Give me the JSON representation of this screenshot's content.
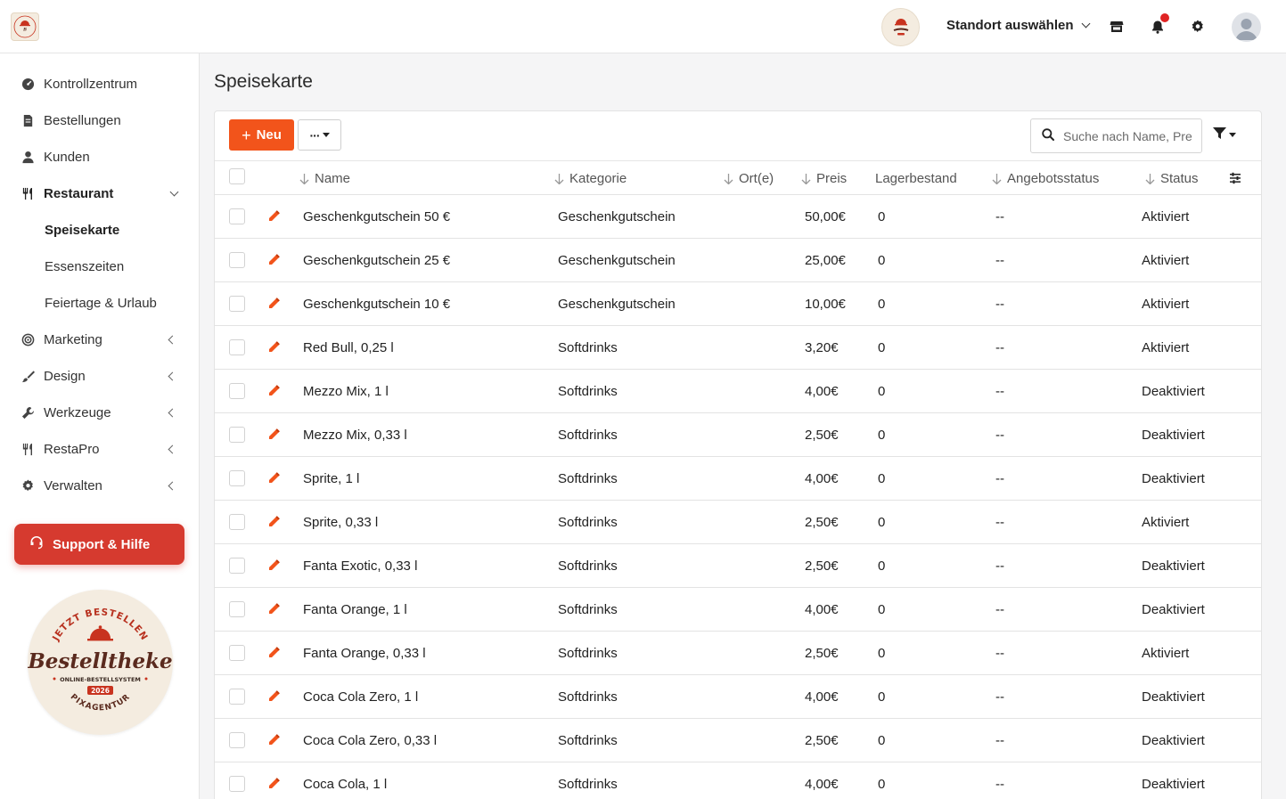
{
  "header": {
    "location_label": "Standort auswählen",
    "colors": {
      "accent": "#f2541b",
      "support": "#d63a2f",
      "notif": "#e02424"
    }
  },
  "sidebar": {
    "items": [
      {
        "label": "Kontrollzentrum",
        "icon": "gauge-icon"
      },
      {
        "label": "Bestellungen",
        "icon": "receipt-icon"
      },
      {
        "label": "Kunden",
        "icon": "user-icon"
      },
      {
        "label": "Restaurant",
        "icon": "utensils-icon"
      },
      {
        "label": "Marketing",
        "icon": "bullseye-icon"
      },
      {
        "label": "Design",
        "icon": "brush-icon"
      },
      {
        "label": "Werkzeuge",
        "icon": "wrench-icon"
      },
      {
        "label": "RestaPro",
        "icon": "utensils-icon"
      },
      {
        "label": "Verwalten",
        "icon": "gear-icon"
      }
    ],
    "subitems": [
      "Speisekarte",
      "Essenszeiten",
      "Feiertage & Urlaub"
    ],
    "support_label": "Support & Hilfe",
    "badge": {
      "top": "JETZT BESTELLEN",
      "name": "Bestelltheke",
      "tagline": "ONLINE-BESTELLSYSTEM",
      "year": "2026",
      "bottom": "PIXAGENTUR"
    }
  },
  "main": {
    "title": "Speisekarte",
    "new_label": "Neu",
    "more_label": "···",
    "search_placeholder": "Suche nach Name, Preis",
    "columns": [
      "Name",
      "Kategorie",
      "Ort(e)",
      "Preis",
      "Lagerbestand",
      "Angebotsstatus",
      "Status"
    ],
    "rows": [
      {
        "name": "Geschenkgutschein 50 €",
        "category": "Geschenkgutschein",
        "price": "50,00€",
        "stock": "0",
        "offer": "--",
        "status": "Aktiviert"
      },
      {
        "name": "Geschenkgutschein 25 €",
        "category": "Geschenkgutschein",
        "price": "25,00€",
        "stock": "0",
        "offer": "--",
        "status": "Aktiviert"
      },
      {
        "name": "Geschenkgutschein 10 €",
        "category": "Geschenkgutschein",
        "price": "10,00€",
        "stock": "0",
        "offer": "--",
        "status": "Aktiviert"
      },
      {
        "name": "Red Bull, 0,25 l",
        "category": "Softdrinks",
        "price": "3,20€",
        "stock": "0",
        "offer": "--",
        "status": "Aktiviert"
      },
      {
        "name": "Mezzo Mix, 1 l",
        "category": "Softdrinks",
        "price": "4,00€",
        "stock": "0",
        "offer": "--",
        "status": "Deaktiviert"
      },
      {
        "name": "Mezzo Mix, 0,33 l",
        "category": "Softdrinks",
        "price": "2,50€",
        "stock": "0",
        "offer": "--",
        "status": "Deaktiviert"
      },
      {
        "name": "Sprite, 1 l",
        "category": "Softdrinks",
        "price": "4,00€",
        "stock": "0",
        "offer": "--",
        "status": "Deaktiviert"
      },
      {
        "name": "Sprite, 0,33 l",
        "category": "Softdrinks",
        "price": "2,50€",
        "stock": "0",
        "offer": "--",
        "status": "Aktiviert"
      },
      {
        "name": "Fanta Exotic, 0,33 l",
        "category": "Softdrinks",
        "price": "2,50€",
        "stock": "0",
        "offer": "--",
        "status": "Deaktiviert"
      },
      {
        "name": "Fanta Orange, 1 l",
        "category": "Softdrinks",
        "price": "4,00€",
        "stock": "0",
        "offer": "--",
        "status": "Deaktiviert"
      },
      {
        "name": "Fanta Orange, 0,33 l",
        "category": "Softdrinks",
        "price": "2,50€",
        "stock": "0",
        "offer": "--",
        "status": "Aktiviert"
      },
      {
        "name": "Coca Cola Zero, 1 l",
        "category": "Softdrinks",
        "price": "4,00€",
        "stock": "0",
        "offer": "--",
        "status": "Deaktiviert"
      },
      {
        "name": "Coca Cola Zero, 0,33 l",
        "category": "Softdrinks",
        "price": "2,50€",
        "stock": "0",
        "offer": "--",
        "status": "Deaktiviert"
      },
      {
        "name": "Coca Cola, 1 l",
        "category": "Softdrinks",
        "price": "4,00€",
        "stock": "0",
        "offer": "--",
        "status": "Deaktiviert"
      }
    ]
  }
}
